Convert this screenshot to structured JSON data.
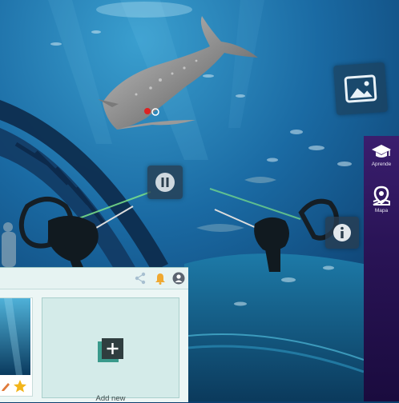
{
  "sidebar": {
    "items": [
      {
        "label": "Aprende",
        "icon": "graduation-cap-icon"
      },
      {
        "label": "Mapa",
        "icon": "map-pin-icon"
      }
    ]
  },
  "vr_controls": {
    "pause_icon": "pause-icon",
    "info_icon": "info-icon",
    "image_icon": "image-icon"
  },
  "panel": {
    "toolbar_icons": [
      "share-icon",
      "bell-icon",
      "user-icon"
    ],
    "add_card": {
      "label": "Add new",
      "icon": "plus-icon"
    },
    "thumbnail_actions": [
      "edit-icon",
      "star-icon"
    ]
  },
  "colors": {
    "sidebar": "#2a1457",
    "panel_bg": "#ecf6f5",
    "add_card_bg": "#d4ebe9",
    "accent_teal": "#2d8a80",
    "star": "#f2b51b",
    "bell": "#f0a830",
    "laser": "#7be38a"
  }
}
